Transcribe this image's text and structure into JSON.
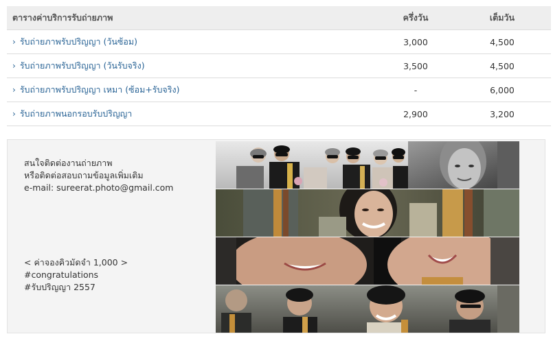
{
  "table": {
    "headers": {
      "name": "ตารางค่าบริการรับถ่ายภาพ",
      "half_day": "ครึ่งวัน",
      "full_day": "เต็มวัน"
    },
    "rows": [
      {
        "name": "รับถ่ายภาพรับปริญญา (วันซ้อม)",
        "half_day": "3,000",
        "full_day": "4,500"
      },
      {
        "name": "รับถ่ายภาพรับปริญญา (วันรับจริง)",
        "half_day": "3,500",
        "full_day": "4,500"
      },
      {
        "name": "รับถ่ายภาพรับปริญญา เหมา (ซ้อม+รับจริง)",
        "half_day": "-",
        "full_day": "6,000"
      },
      {
        "name": "รับถ่ายภาพนอกรอบรับปริญญา",
        "half_day": "2,900",
        "full_day": "3,200"
      }
    ],
    "row_icon": "chevron-right-icon",
    "link_color": "#2a6496"
  },
  "contact": {
    "line1": "สนใจติดต่องานถ่ายภาพ",
    "line2": "หรือติดต่อสอบถามข้อมูลเพิ่มเติม",
    "email": "e-mail: sureerat.photo@gmail.com"
  },
  "promo": {
    "deposit": "< ค่าจองคิวมัดจำ 1,000 >",
    "tag1": "#congratulations",
    "tag2": "#รับปริญญา 2557"
  },
  "collage": {
    "description_free": true
  }
}
